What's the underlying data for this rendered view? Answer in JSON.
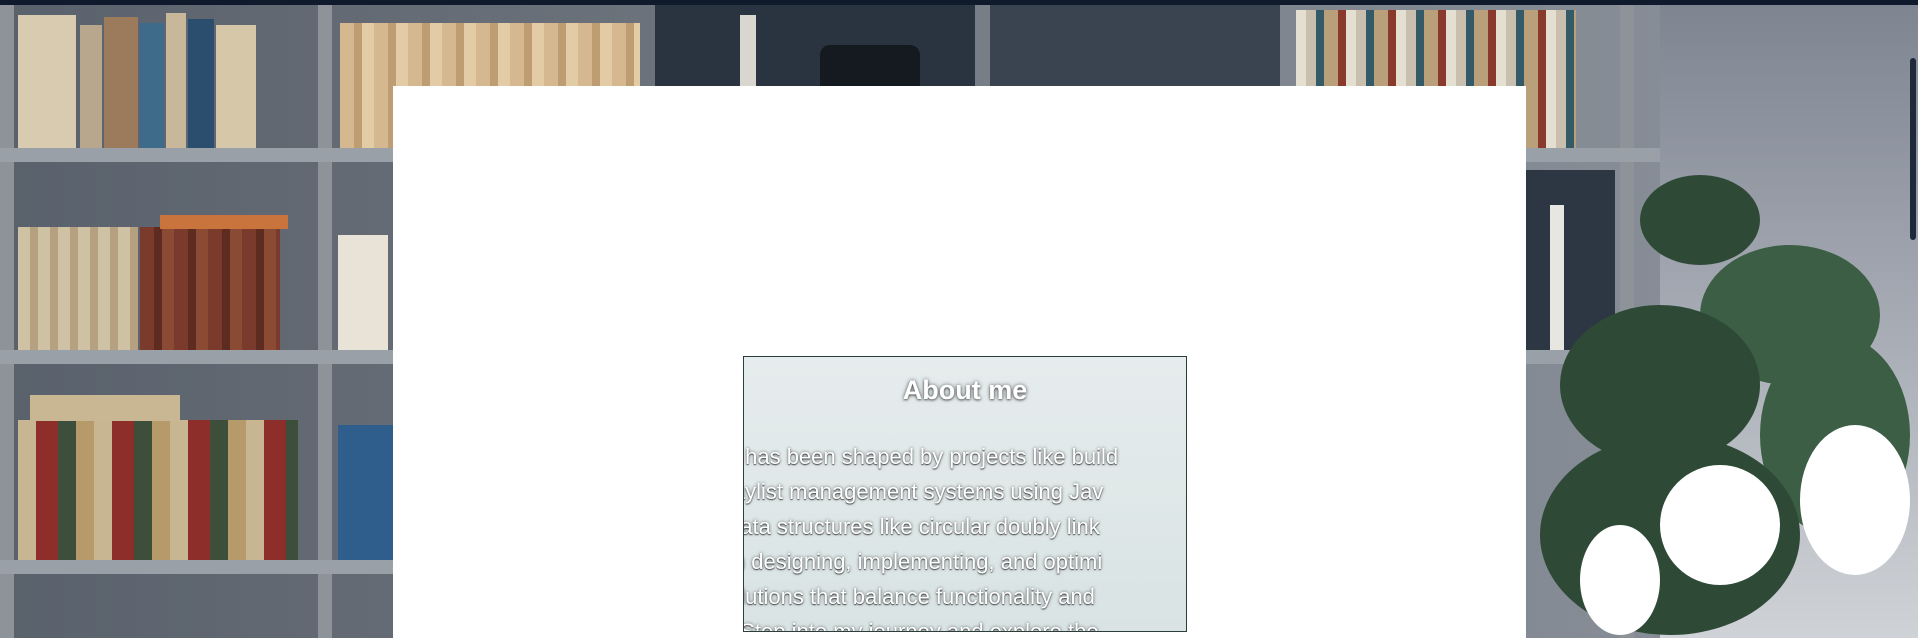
{
  "about": {
    "title": "About me",
    "lines": [
      "y has been shaped by projects like build",
      "laylist management systems using Jav",
      "data structures like circular doubly link",
      "in designing, implementing, and optimi",
      "olutions that balance functionality and",
      ". Step into my journey and explore the"
    ]
  },
  "colors": {
    "panel": "#ffffff",
    "card": "#e0e8e8",
    "topbar": "#0f1b2d"
  },
  "icons": {
    "background": "bookshelf-background-image"
  }
}
